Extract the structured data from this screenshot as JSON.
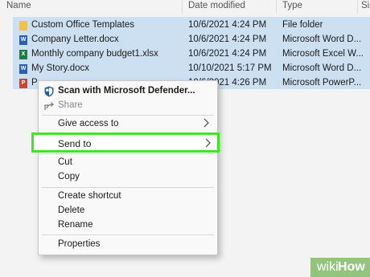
{
  "columns": {
    "name": "Name",
    "date": "Date modified",
    "type": "Type",
    "size": "Siz"
  },
  "files": [
    {
      "name": "Custom Office Templates",
      "date": "10/6/2021 4:24 PM",
      "type": "File folder",
      "icon": "folder-icon"
    },
    {
      "name": "Company Letter.docx",
      "date": "10/6/2021 4:24 PM",
      "type": "Microsoft Word D...",
      "icon": "word-icon"
    },
    {
      "name": "Monthly company budget1.xlsx",
      "date": "10/6/2021 4:24 PM",
      "type": "Microsoft Excel W...",
      "icon": "excel-icon"
    },
    {
      "name": "My Story.docx",
      "date": "10/10/2021 5:17 PM",
      "type": "Microsoft Word D...",
      "icon": "word-icon"
    },
    {
      "name": "P",
      "date": "10/6/2021 4:26 PM",
      "type": "Microsoft PowerP...",
      "icon": "powerpoint-icon"
    }
  ],
  "context_menu": {
    "scan": "Scan with Microsoft Defender...",
    "share": "Share",
    "give_access": "Give access to",
    "send_to": "Send to",
    "cut": "Cut",
    "copy": "Copy",
    "create_shortcut": "Create shortcut",
    "delete": "Delete",
    "rename": "Rename",
    "properties": "Properties"
  },
  "watermark": {
    "part1": "wiki",
    "part2": "How"
  },
  "colors": {
    "selection": "#cde0f2",
    "highlight_border": "#3ee81f",
    "watermark_bg": "#93c47d"
  }
}
